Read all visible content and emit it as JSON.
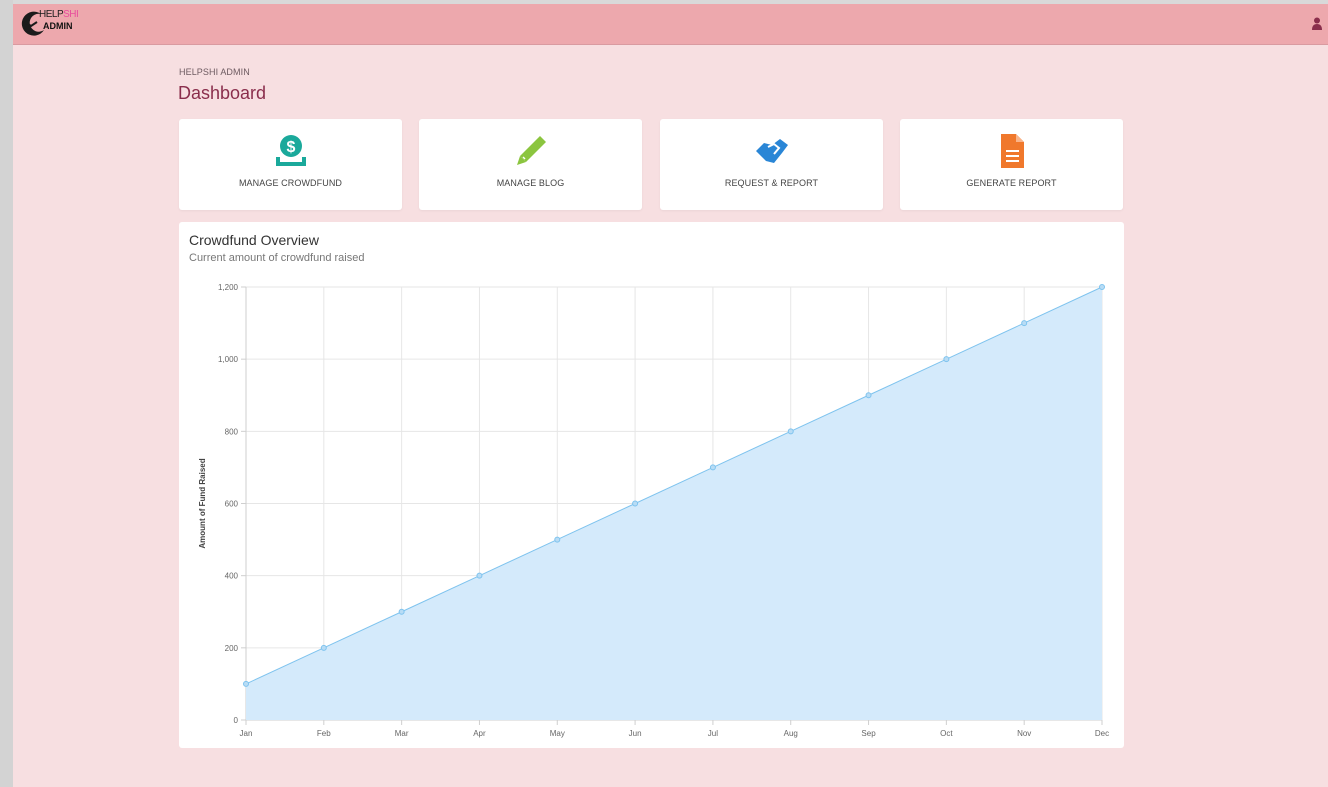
{
  "app": {
    "logo_top_dark": "HELP",
    "logo_top_pink": "SHI",
    "logo_bottom": "ADMIN"
  },
  "header": {
    "breadcrumb": "HELPSHI ADMIN",
    "title": "Dashboard"
  },
  "cards": [
    {
      "label": "MANAGE CROWDFUND",
      "icon": "money-hand-icon",
      "color": "#1aa99b"
    },
    {
      "label": "MANAGE BLOG",
      "icon": "pencil-icon",
      "color": "#8bc53f"
    },
    {
      "label": "REQUEST & REPORT",
      "icon": "handshake-icon",
      "color": "#2a86d6"
    },
    {
      "label": "GENERATE REPORT",
      "icon": "document-icon",
      "color": "#f0782c"
    }
  ],
  "chart_panel": {
    "title": "Crowdfund Overview",
    "subtitle": "Current amount of crowdfund raised"
  },
  "chart_data": {
    "type": "area",
    "categories": [
      "Jan",
      "Feb",
      "Mar",
      "Apr",
      "May",
      "Jun",
      "Jul",
      "Aug",
      "Sep",
      "Oct",
      "Nov",
      "Dec"
    ],
    "values": [
      100,
      200,
      300,
      400,
      500,
      600,
      700,
      800,
      900,
      1000,
      1100,
      1200
    ],
    "ylabel": "Amount of Fund Raised",
    "ylim": [
      0,
      1200
    ],
    "yticks": [
      0,
      200,
      400,
      600,
      800,
      1000,
      1200
    ],
    "ytick_labels": [
      "0",
      "200",
      "400",
      "600",
      "800",
      "1,000",
      "1,200"
    ],
    "grid": true,
    "line_color": "#7ec3ee",
    "fill_color": "#d4eafb"
  },
  "colors": {
    "navbar": "#eda8ad",
    "background": "#f7dfe1",
    "title": "#8a2e4c"
  }
}
